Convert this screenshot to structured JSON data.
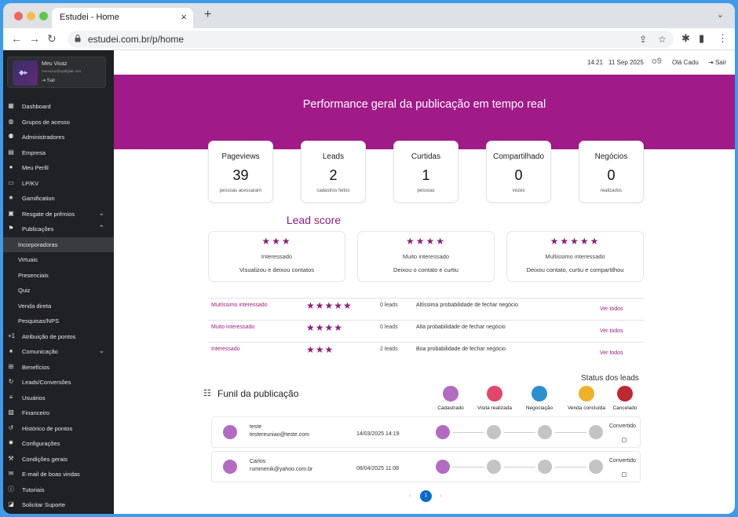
{
  "browser": {
    "tab_title": "Estudei - Home",
    "url": "estudei.com.br/p/home"
  },
  "sidebar": {
    "profile": {
      "name": "Meu Vivaz",
      "email": "meuvivaz@opdigital.com",
      "logout": "Sair"
    },
    "items": [
      {
        "label": "Dashboard",
        "icon": "grid-icon"
      },
      {
        "label": "Grupos de acesso",
        "icon": "globe-icon"
      },
      {
        "label": "Administradores",
        "icon": "users-icon"
      },
      {
        "label": "Empresa",
        "icon": "building-icon"
      },
      {
        "label": "Meu Perfil",
        "icon": "user-icon"
      },
      {
        "label": "LP/KV",
        "icon": "window-icon"
      },
      {
        "label": "Gamification",
        "icon": "star-icon"
      },
      {
        "label": "Resgate de prêmios",
        "icon": "gift-icon",
        "chevron": "down"
      },
      {
        "label": "Publicações",
        "icon": "flag-icon",
        "chevron": "up"
      }
    ],
    "subitems": [
      {
        "label": "Incorporadoras",
        "active": true
      },
      {
        "label": "Virtuais"
      },
      {
        "label": "Presenciais"
      },
      {
        "label": "Quiz"
      },
      {
        "label": "Venda direta"
      },
      {
        "label": "Pesquisas/NPS"
      }
    ],
    "items2": [
      {
        "label": "Atribuição de pontos",
        "icon": "plus-one-icon"
      },
      {
        "label": "Comunicação",
        "icon": "bell-icon",
        "chevron": "down"
      },
      {
        "label": "Benefícios",
        "icon": "plus-box-icon"
      },
      {
        "label": "Leads/Conversões",
        "icon": "refresh-icon"
      },
      {
        "label": "Usuários",
        "icon": "list-icon"
      },
      {
        "label": "Financeiro",
        "icon": "wallet-icon"
      },
      {
        "label": "Histórico de pontos",
        "icon": "history-icon"
      },
      {
        "label": "Configurações",
        "icon": "gear-icon"
      },
      {
        "label": "Condições gerais",
        "icon": "gavel-icon"
      },
      {
        "label": "E-mail de boas vindas",
        "icon": "mail-icon"
      },
      {
        "label": "Tutoriais",
        "icon": "info-icon"
      },
      {
        "label": "Solicitar Suporte",
        "icon": "support-icon"
      }
    ]
  },
  "header": {
    "time": "14:21",
    "date": "11 Sep 2025",
    "greeting": "Olá Cadu",
    "logout": "Sair"
  },
  "banner": {
    "title": "Performance geral da publicação em tempo real"
  },
  "stats": [
    {
      "title": "Pageviews",
      "value": "39",
      "sub": "pessoas acessaram"
    },
    {
      "title": "Leads",
      "value": "2",
      "sub": "cadastros feitos"
    },
    {
      "title": "Curtidas",
      "value": "1",
      "sub": "pessoas"
    },
    {
      "title": "Compartilhado",
      "value": "0",
      "sub": "vezes"
    },
    {
      "title": "Negócios",
      "value": "0",
      "sub": "realizados"
    }
  ],
  "lead_score": {
    "title": "Lead score",
    "cards": [
      {
        "stars": "★★★",
        "name": "Interessado",
        "desc": "Visualizou e deixou contatos"
      },
      {
        "stars": "★★★★",
        "name": "Muito interessado",
        "desc": "Deixou o contato e curtiu"
      },
      {
        "stars": "★★★★★",
        "name": "Multissimo interessado",
        "desc": "Deixou contato, curtiu e compartilhou"
      }
    ],
    "rows": [
      {
        "name": "Muitíssimo interessado",
        "stars": "★★★★★",
        "leads": "0 leads",
        "desc": "Altíssima probabilidade de fechar negócio",
        "link": "Ver todos"
      },
      {
        "name": "Muito interessado",
        "stars": "★★★★",
        "leads": "0 leads",
        "desc": "Alta probabilidade de fechar negócio",
        "link": "Ver todos"
      },
      {
        "name": "Interessado",
        "stars": "★★★",
        "leads": "2 leads",
        "desc": "Boa probabilidade de fechar negócio",
        "link": "Ver todos"
      }
    ]
  },
  "status": {
    "title": "Status dos leads",
    "items": [
      {
        "label": "Cadastrado",
        "color": "#b36bc2"
      },
      {
        "label": "Visita realizada",
        "color": "#e0476a"
      },
      {
        "label": "Negociação",
        "color": "#2e8fcf"
      },
      {
        "label": "Venda concluída",
        "color": "#f0b12a"
      },
      {
        "label": "Cancelado",
        "color": "#c0282f"
      }
    ]
  },
  "funnel": {
    "title": "Funil da publicação",
    "leads": [
      {
        "name": "teste",
        "email": "testereuniao@teste.com",
        "date": "14/03/2025 14:19",
        "status": "Convertido"
      },
      {
        "name": "Carlos",
        "email": "rummenik@yahoo.com.br",
        "date": "08/04/2025 11:08",
        "status": "Convertido"
      }
    ]
  },
  "pagination": {
    "current": "1"
  }
}
